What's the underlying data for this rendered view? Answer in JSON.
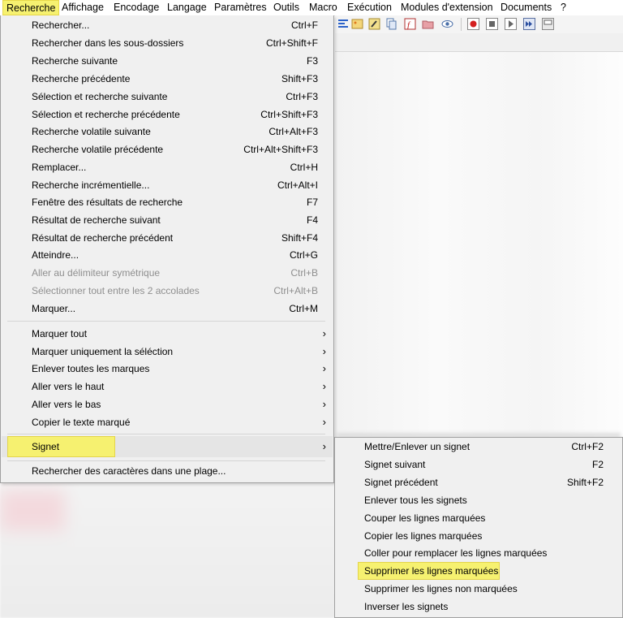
{
  "menubar": {
    "items": [
      "Recherche",
      "Affichage",
      "Encodage",
      "Langage",
      "Paramètres",
      "Outils",
      "Macro",
      "Exécution",
      "Modules d'extension",
      "Documents",
      "?"
    ]
  },
  "toolbar": {
    "icons": [
      "align-icon",
      "image-icon",
      "pen-icon",
      "copy-icon",
      "function-icon",
      "folder-icon",
      "eye-icon",
      "record-icon",
      "stop-icon",
      "play-icon",
      "fast-forward-icon",
      "save-macro-icon"
    ]
  },
  "search_menu": {
    "items": [
      {
        "label": "Rechercher...",
        "shortcut": "Ctrl+F"
      },
      {
        "label": "Rechercher dans les sous-dossiers",
        "shortcut": "Ctrl+Shift+F"
      },
      {
        "label": "Recherche suivante",
        "shortcut": "F3"
      },
      {
        "label": "Recherche précédente",
        "shortcut": "Shift+F3"
      },
      {
        "label": "Sélection et recherche suivante",
        "shortcut": "Ctrl+F3"
      },
      {
        "label": "Sélection et recherche précédente",
        "shortcut": "Ctrl+Shift+F3"
      },
      {
        "label": "Recherche volatile suivante",
        "shortcut": "Ctrl+Alt+F3"
      },
      {
        "label": "Recherche volatile précédente",
        "shortcut": "Ctrl+Alt+Shift+F3"
      },
      {
        "label": "Remplacer...",
        "shortcut": "Ctrl+H"
      },
      {
        "label": "Recherche incrémentielle...",
        "shortcut": "Ctrl+Alt+I"
      },
      {
        "label": "Fenêtre des résultats de recherche",
        "shortcut": "F7"
      },
      {
        "label": "Résultat de recherche suivant",
        "shortcut": "F4"
      },
      {
        "label": "Résultat de recherche précédent",
        "shortcut": "Shift+F4"
      },
      {
        "label": "Atteindre...",
        "shortcut": "Ctrl+G"
      },
      {
        "label": "Aller au délimiteur symétrique",
        "shortcut": "Ctrl+B"
      },
      {
        "label": "Sélectionner tout entre les 2 accolades",
        "shortcut": "Ctrl+Alt+B"
      },
      {
        "label": "Marquer...",
        "shortcut": "Ctrl+M"
      }
    ],
    "mark_items": [
      {
        "label": "Marquer tout"
      },
      {
        "label": "Marquer uniquement la séléction"
      },
      {
        "label": "Enlever toutes les marques"
      },
      {
        "label": "Aller vers le haut"
      },
      {
        "label": "Aller vers le bas"
      },
      {
        "label": "Copier le texte marqué"
      }
    ],
    "bookmark_label": "Signet",
    "range_search_label": "Rechercher des caractères dans une plage...",
    "submenu_arrow": "›"
  },
  "bookmark_submenu": {
    "items": [
      {
        "label": "Mettre/Enlever un signet",
        "shortcut": "Ctrl+F2"
      },
      {
        "label": "Signet suivant",
        "shortcut": "F2"
      },
      {
        "label": "Signet précédent",
        "shortcut": "Shift+F2"
      },
      {
        "label": "Enlever tous les signets",
        "shortcut": ""
      },
      {
        "label": "Couper les lignes marquées",
        "shortcut": ""
      },
      {
        "label": "Copier les lignes marquées",
        "shortcut": ""
      },
      {
        "label": "Coller pour remplacer les lignes marquées",
        "shortcut": ""
      },
      {
        "label": "Supprimer les lignes marquées",
        "shortcut": ""
      },
      {
        "label": "Supprimer les lignes non marquées",
        "shortcut": ""
      },
      {
        "label": "Inverser les signets",
        "shortcut": ""
      }
    ]
  },
  "colors": {
    "highlight": "#f6f170",
    "menu_bg": "#f0f0f0",
    "disabled_text": "#8f8f8f"
  }
}
